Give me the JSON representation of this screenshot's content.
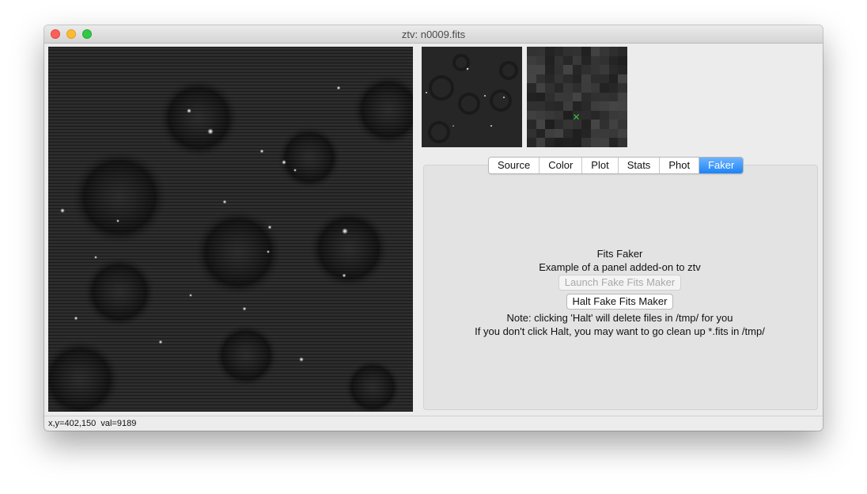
{
  "window": {
    "title": "ztv: n0009.fits"
  },
  "tabs": [
    {
      "label": "Source",
      "active": false
    },
    {
      "label": "Color",
      "active": false
    },
    {
      "label": "Plot",
      "active": false
    },
    {
      "label": "Stats",
      "active": false
    },
    {
      "label": "Phot",
      "active": false
    },
    {
      "label": "Faker",
      "active": true
    }
  ],
  "faker": {
    "heading": "Fits Faker",
    "description": "Example of a panel added-on to ztv",
    "launch_label": "Launch Fake Fits Maker",
    "launch_enabled": false,
    "halt_label": "Halt Fake Fits Maker",
    "note": "Note: clicking 'Halt' will delete files in /tmp/ for you",
    "warning": "If you don't click Halt, you may want to go clean up *.fits in /tmp/"
  },
  "status": {
    "coords": "x,y=402,150  val=9189"
  },
  "colors": {
    "active_tab": "#1b84f7",
    "crosshair": "#3fbf3f"
  },
  "icons": [
    "close-icon",
    "minimize-icon",
    "zoom-icon",
    "crosshair-icon"
  ]
}
